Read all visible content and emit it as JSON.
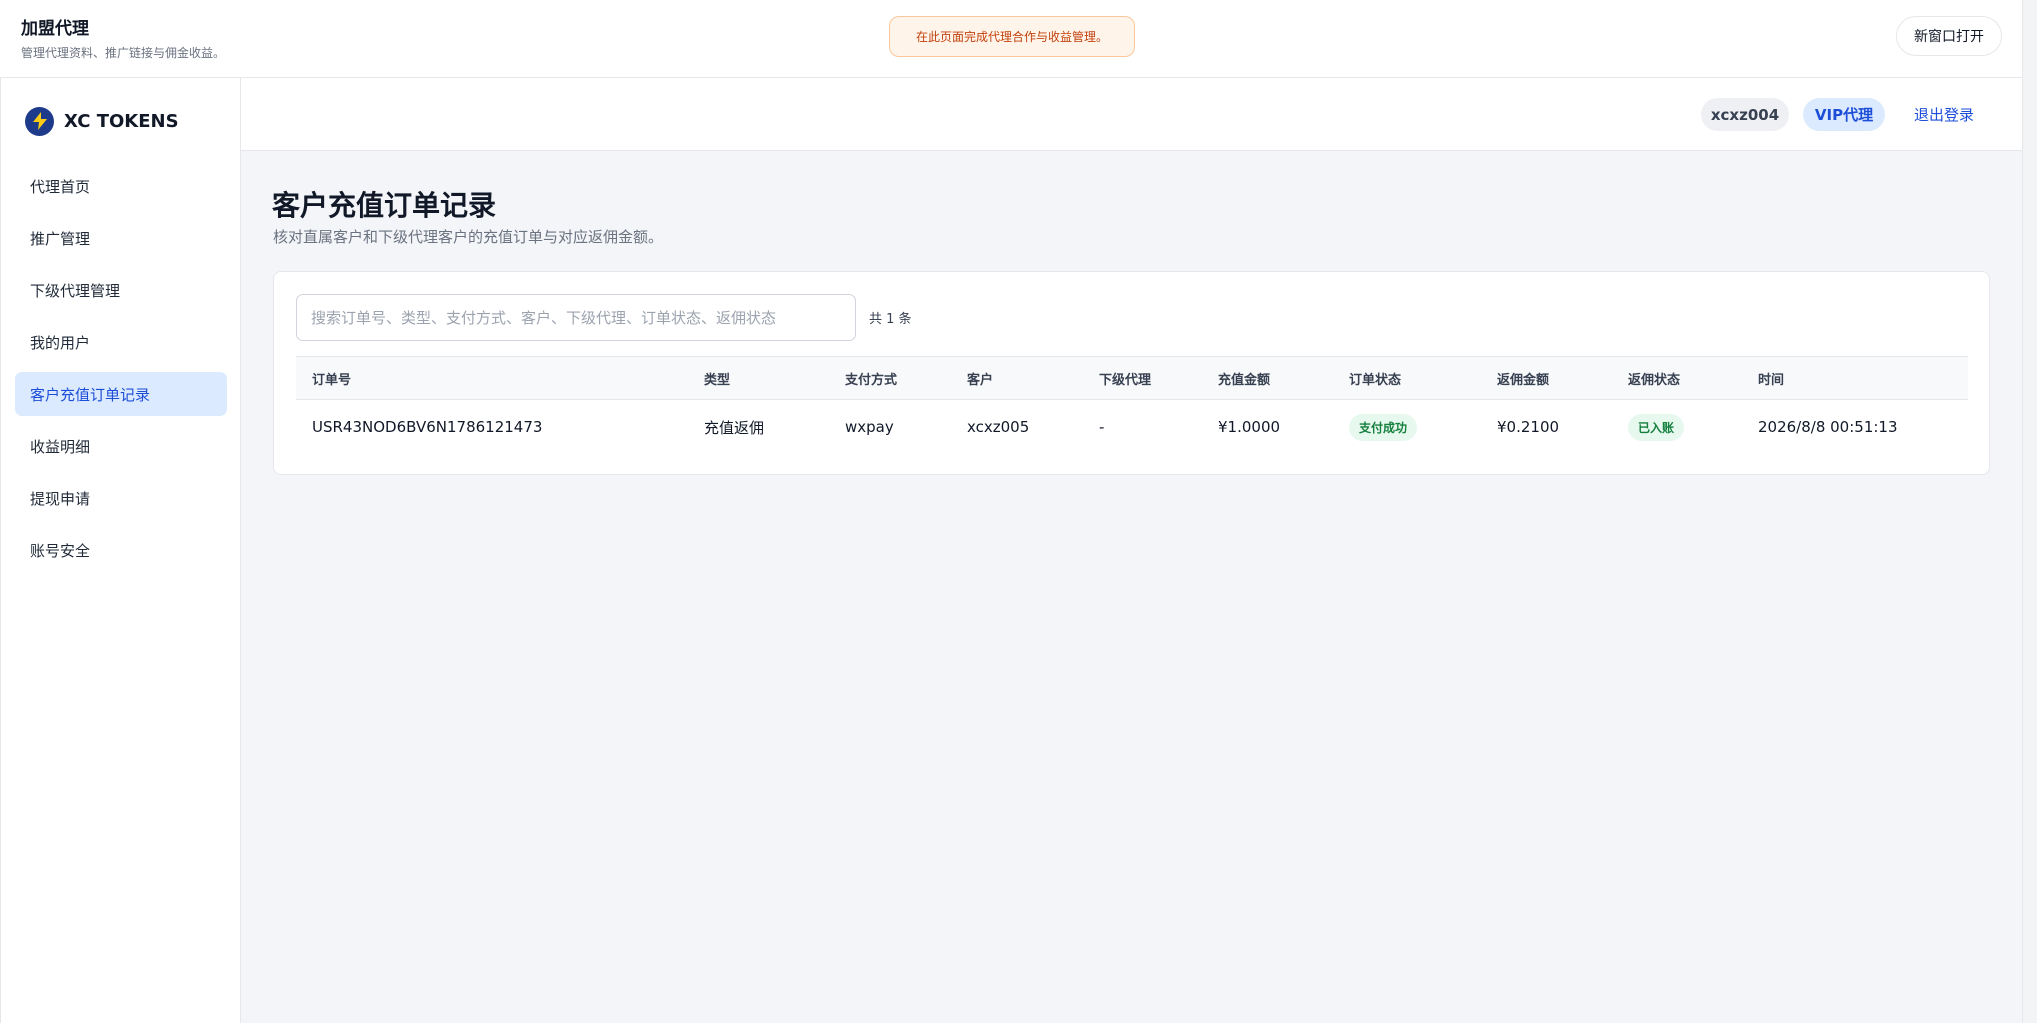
{
  "topbar": {
    "title": "加盟代理",
    "subtitle": "管理代理资料、推广链接与佣金收益。",
    "notice": "在此页面完成代理合作与收益管理。",
    "open_window_label": "新窗口打开"
  },
  "brand": {
    "name": "XC TOKENS",
    "logo_icon": "lightning-bolt-icon",
    "logo_colors": {
      "background": "#1e3a8a",
      "bolt": "#facc15"
    }
  },
  "sidebar": {
    "items": [
      {
        "label": "代理首页",
        "active": false
      },
      {
        "label": "推广管理",
        "active": false
      },
      {
        "label": "下级代理管理",
        "active": false
      },
      {
        "label": "我的用户",
        "active": false
      },
      {
        "label": "客户充值订单记录",
        "active": true
      },
      {
        "label": "收益明细",
        "active": false
      },
      {
        "label": "提现申请",
        "active": false
      },
      {
        "label": "账号安全",
        "active": false
      }
    ]
  },
  "userbar": {
    "username": "xcxz004",
    "level": "VIP代理",
    "logout_label": "退出登录"
  },
  "main": {
    "title": "客户充值订单记录",
    "description": "核对直属客户和下级代理客户的充值订单与对应返佣金额。",
    "search": {
      "placeholder": "搜索订单号、类型、支付方式、客户、下级代理、订单状态、返佣状态",
      "value": ""
    },
    "count_label": "共 1 条",
    "table": {
      "columns": [
        "订单号",
        "类型",
        "支付方式",
        "客户",
        "下级代理",
        "充值金额",
        "订单状态",
        "返佣金额",
        "返佣状态",
        "时间"
      ],
      "rows": [
        {
          "order_no": "USR43NOD6BV6N1786121473",
          "type": "充值返佣",
          "payment": "wxpay",
          "customer": "xcxz005",
          "sub_agent": "-",
          "amount": "¥1.0000",
          "order_status": "支付成功",
          "rebate_amount": "¥0.2100",
          "rebate_status": "已入账",
          "time": "2026/8/8 00:51:13"
        }
      ]
    }
  },
  "colors": {
    "accent": "#1d4ed8",
    "accent_bg": "#dbeafe",
    "success_text": "#15803d",
    "success_bg": "#e7f8ef",
    "notice_text": "#c2410c",
    "notice_bg": "#fff4ea"
  }
}
